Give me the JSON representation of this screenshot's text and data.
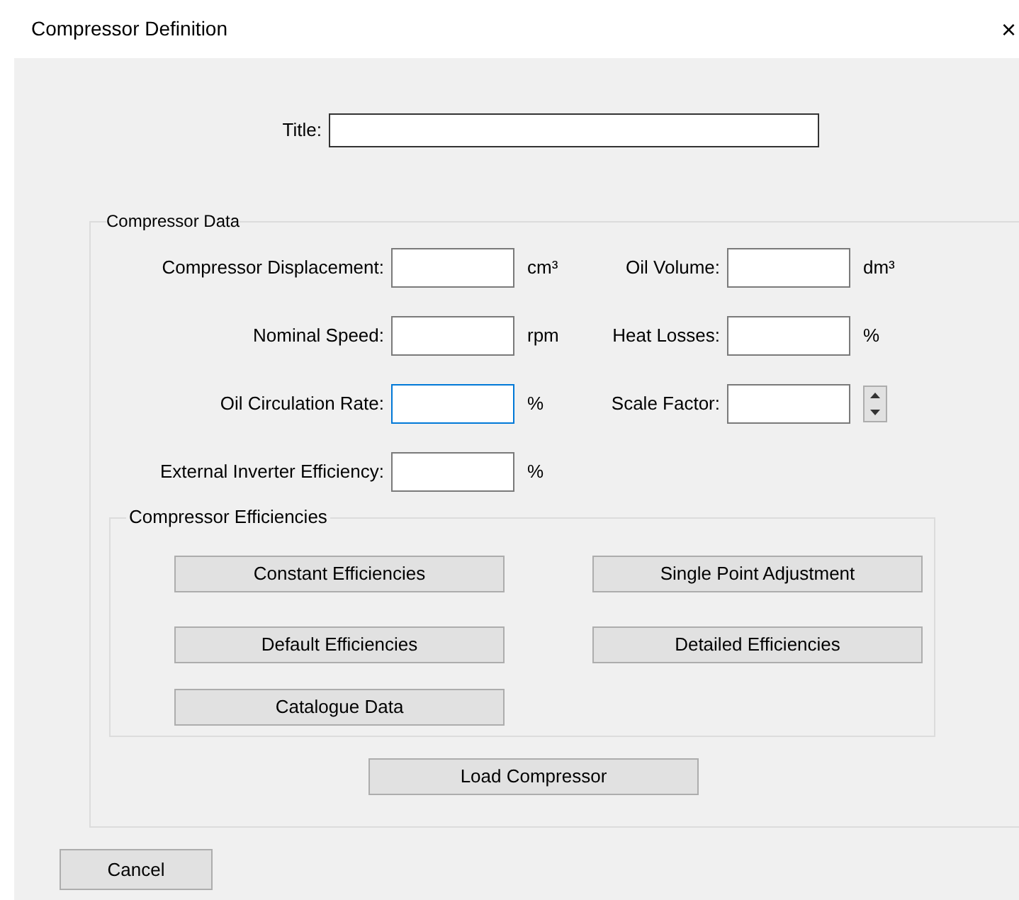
{
  "window": {
    "title": "Compressor Definition",
    "close": "×"
  },
  "title_field": {
    "label": "Title:"
  },
  "compressor_data": {
    "title": "Compressor Data",
    "rows": [
      {
        "fields": [
          {
            "label": "Compressor Displacement:",
            "kind": "unit",
            "unit": "cm³",
            "focused": false
          },
          {
            "label": "Oil Volume:",
            "kind": "unit",
            "unit": "dm³",
            "focused": false
          }
        ]
      },
      {
        "fields": [
          {
            "label": "Nominal Speed:",
            "kind": "unit",
            "unit": "rpm",
            "focused": false
          },
          {
            "label": "Heat Losses:",
            "kind": "unit",
            "unit": "%",
            "focused": false
          }
        ]
      },
      {
        "fields": [
          {
            "label": "Oil Circulation Rate:",
            "kind": "unit",
            "unit": "%",
            "focused": true
          },
          {
            "label": "Scale Factor:",
            "kind": "spinner",
            "focused": false
          }
        ]
      },
      {
        "fields": [
          {
            "label": "External Inverter Efficiency:",
            "kind": "unit",
            "unit": "%",
            "focused": false
          }
        ]
      }
    ],
    "efficiencies": {
      "title": "Compressor Efficiencies",
      "buttons": [
        "Constant Efficiencies",
        "Single Point Adjustment",
        "Default Efficiencies",
        "Detailed Efficiencies",
        "Catalogue Data"
      ]
    },
    "load_button": "Load Compressor"
  },
  "buttons": [
    "Cancel"
  ]
}
